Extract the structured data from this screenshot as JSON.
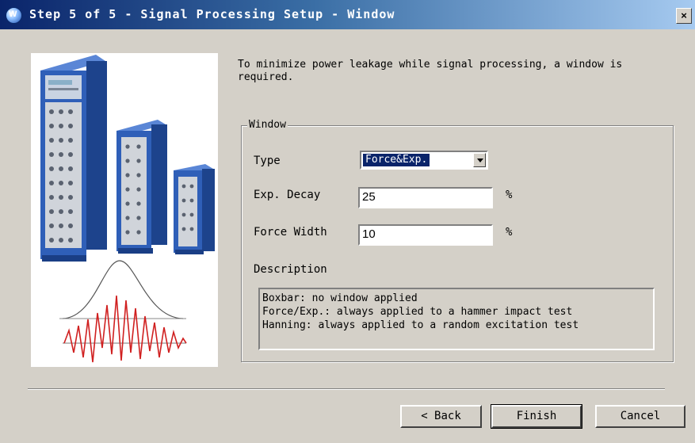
{
  "window": {
    "title": "Step 5 of 5 - Signal Processing Setup - Window",
    "icon": "app-globe-icon",
    "icon_letter": "W",
    "close_icon": "close-icon",
    "close_glyph": "×"
  },
  "intro_text": "To minimize power leakage while signal processing, a window is required.",
  "window_group": {
    "legend": "Window",
    "type": {
      "label": "Type",
      "selected": "Force&Exp."
    },
    "exp_decay": {
      "label": "Exp. Decay",
      "value": "25",
      "unit": "%"
    },
    "force_width": {
      "label": "Force Width",
      "value": "10",
      "unit": "%"
    },
    "description": {
      "label": "Description",
      "lines": [
        "Boxbar: no window applied",
        "Force/Exp.: always applied to a hammer impact test",
        "Hanning: always applied to a random excitation test"
      ]
    }
  },
  "buttons": {
    "back": "< Back",
    "finish": "Finish",
    "cancel": "Cancel"
  },
  "colors": {
    "title_bar": "#0a246a",
    "dialog_bg": "#d4d0c8",
    "hardware_blue": "#2f5fb8",
    "waveform_red": "#d02020"
  }
}
